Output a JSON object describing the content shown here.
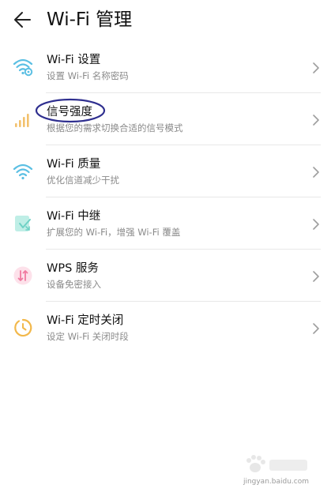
{
  "header": {
    "title": "Wi-Fi 管理",
    "back_icon": "arrow-left-icon"
  },
  "items": [
    {
      "title": "Wi-Fi 设置",
      "subtitle": "设置 Wi-Fi 名称密码",
      "icon": "wifi-gear-icon",
      "icon_color": "#5bbfe3"
    },
    {
      "title": "信号强度",
      "subtitle": "根据您的需求切换合适的信号模式",
      "icon": "signal-bars-icon",
      "icon_color": "#f2c16d"
    },
    {
      "title": "Wi-Fi 质量",
      "subtitle": "优化信道减少干扰",
      "icon": "wifi-icon",
      "icon_color": "#5bbfe3"
    },
    {
      "title": "Wi-Fi 中继",
      "subtitle": "扩展您的 Wi-Fi，增强 Wi-Fi 覆盖",
      "icon": "repeater-icon",
      "icon_color": "#6fd1c5"
    },
    {
      "title": "WPS 服务",
      "subtitle": "设备免密接入",
      "icon": "wps-icon",
      "icon_color": "#f07aa0"
    },
    {
      "title": "Wi-Fi 定时关闭",
      "subtitle": "设定 Wi-Fi 关闭时段",
      "icon": "timer-icon",
      "icon_color": "#f2b84b"
    }
  ],
  "annotation": {
    "highlight_color": "#2f2f8f"
  },
  "watermark": {
    "text": "jingyan.baidu.com"
  }
}
